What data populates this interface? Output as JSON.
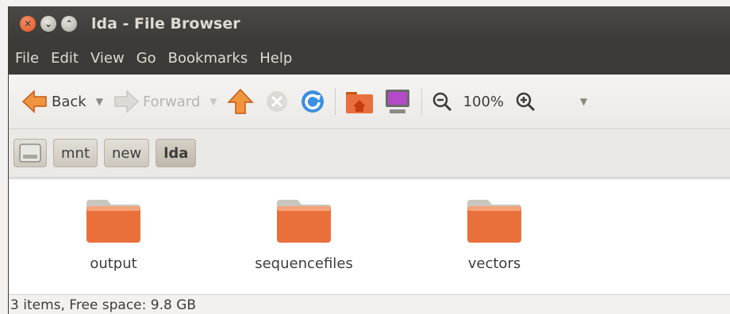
{
  "window": {
    "title": "lda - File Browser",
    "controls": [
      "close-icon",
      "minimize-icon",
      "maximize-icon"
    ]
  },
  "menubar": {
    "items": [
      {
        "label": "File"
      },
      {
        "label": "Edit"
      },
      {
        "label": "View"
      },
      {
        "label": "Go"
      },
      {
        "label": "Bookmarks"
      },
      {
        "label": "Help"
      }
    ]
  },
  "toolbar": {
    "back_label": "Back",
    "forward_label": "Forward",
    "zoom_level": "100%",
    "icons": [
      "back-arrow-icon",
      "forward-arrow-icon",
      "up-arrow-icon",
      "stop-icon",
      "reload-icon",
      "home-folder-icon",
      "computer-icon",
      "zoom-out-icon",
      "zoom-in-icon"
    ]
  },
  "pathbar": {
    "crumbs": [
      {
        "label": "mnt"
      },
      {
        "label": "new"
      },
      {
        "label": "lda"
      }
    ]
  },
  "content": {
    "items": [
      {
        "name": "output",
        "icon": "folder-icon"
      },
      {
        "name": "sequencefiles",
        "icon": "folder-icon"
      },
      {
        "name": "vectors",
        "icon": "folder-icon"
      }
    ]
  },
  "statusbar": {
    "text": "3 items, Free space: 9.8 GB"
  },
  "colors": {
    "titlebar": "#3c3b37",
    "folder_orange": "#e9703b",
    "accent": "#dd4814"
  }
}
